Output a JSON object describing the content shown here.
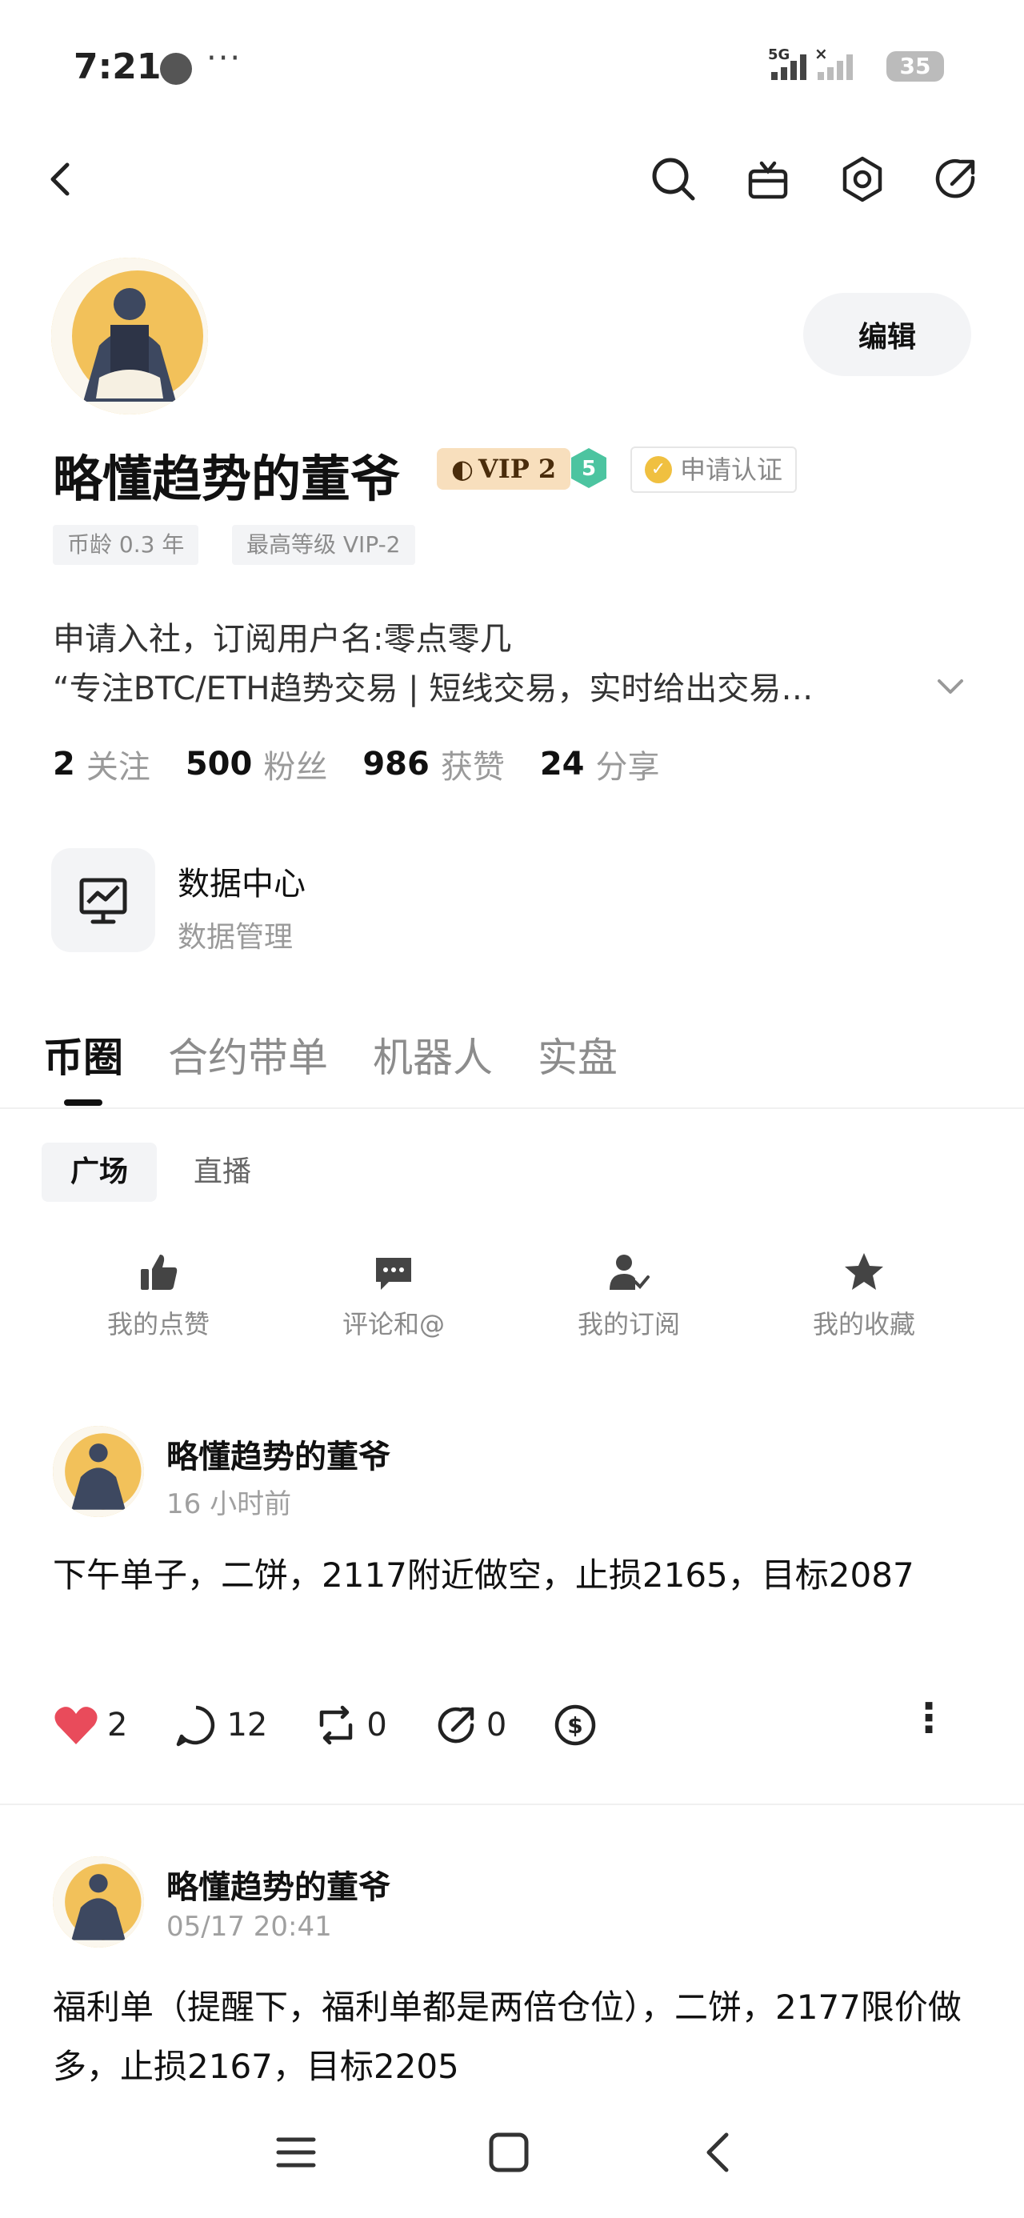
{
  "status_bar": {
    "time": "7:21",
    "extra": "···",
    "network": "5G",
    "battery": "35"
  },
  "profile": {
    "name": "略懂趋势的董爷",
    "vip": "VIP 2",
    "level": "5",
    "verify_label": "申请认证",
    "edit_label": "编辑",
    "tags": [
      "币龄 0.3 年",
      "最高等级 VIP-2"
    ],
    "bio_line1": "申请入社，订阅用户名:零点零几",
    "bio_line2": "“专注BTC/ETH趋势交易 | 短线交易，实时给出交易…",
    "stats": [
      {
        "num": "2",
        "label": "关注"
      },
      {
        "num": "500",
        "label": "粉丝"
      },
      {
        "num": "986",
        "label": "获赞"
      },
      {
        "num": "24",
        "label": "分享"
      }
    ]
  },
  "data_center": {
    "title": "数据中心",
    "subtitle": "数据管理"
  },
  "tabs": [
    "币圈",
    "合约带单",
    "机器人",
    "实盘"
  ],
  "subtabs": [
    "广场",
    "直播"
  ],
  "quick_actions": [
    "我的点赞",
    "评论和@",
    "我的订阅",
    "我的收藏"
  ],
  "posts": [
    {
      "author": "略懂趋势的董爷",
      "time": "16 小时前",
      "body": "下午单子，二饼，2117附近做空，止损2165，目标2087",
      "likes": "2",
      "comments": "12",
      "reposts": "0",
      "shares": "0"
    },
    {
      "author": "略懂趋势的董爷",
      "time": "05/17 20:41",
      "body": "福利单（提醒下，福利单都是两倍仓位），二饼，2177限价做多，止损2167，目标2205"
    }
  ],
  "colors": {
    "vip_bg": "#f8dfbd",
    "like_red": "#e94b5b",
    "level_green": "#4cc4a0",
    "avatar_gold": "#f4c860"
  }
}
